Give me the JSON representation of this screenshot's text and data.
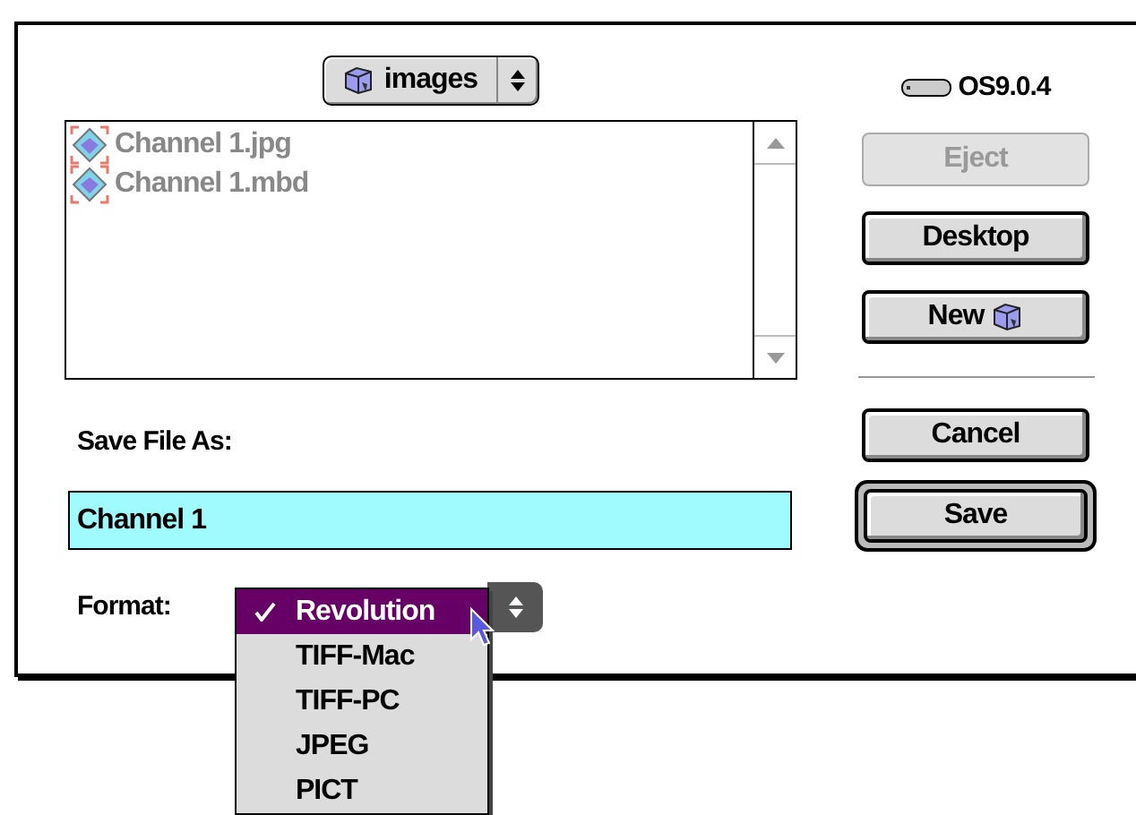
{
  "location_popup": {
    "label": "images"
  },
  "volume": {
    "label": "OS9.0.4"
  },
  "files": [
    {
      "name": "Channel 1.jpg",
      "disabled": true
    },
    {
      "name": "Channel 1.mbd",
      "disabled": true
    }
  ],
  "side_buttons": [
    {
      "label": "Eject",
      "disabled": true,
      "kind": "plain"
    },
    {
      "label": "Desktop",
      "disabled": false,
      "kind": "plain"
    },
    {
      "label": "New",
      "disabled": false,
      "kind": "new-folder"
    }
  ],
  "action_buttons": [
    {
      "label": "Cancel",
      "default": false
    },
    {
      "label": "Save",
      "default": true
    }
  ],
  "save_as": {
    "label": "Save File As:",
    "value": "Channel 1"
  },
  "format": {
    "label": "Format:",
    "expanded": true,
    "options": [
      {
        "label": "Revolution",
        "selected": true
      },
      {
        "label": "TIFF-Mac",
        "selected": false
      },
      {
        "label": "TIFF-PC",
        "selected": false
      },
      {
        "label": "JPEG",
        "selected": false
      },
      {
        "label": "PICT",
        "selected": false
      }
    ]
  }
}
